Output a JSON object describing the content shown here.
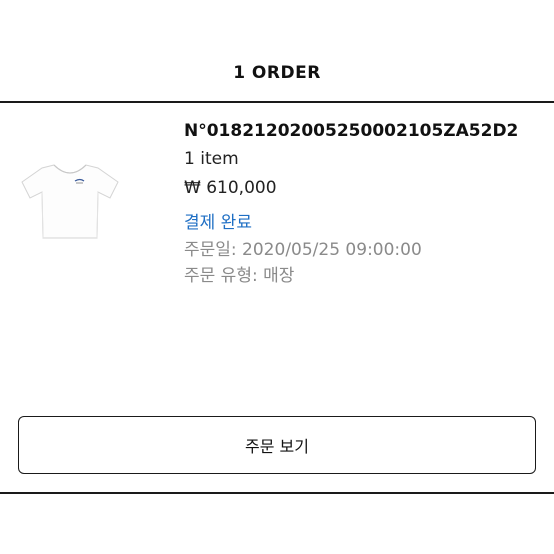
{
  "header": {
    "title": "1 ORDER"
  },
  "order": {
    "number": "N°01821202005250002105ZA52D2",
    "item_count": "1 item",
    "price": "₩ 610,000",
    "status": "결제 완료",
    "status_color": "#1f6fc4",
    "order_date": "주문일: 2020/05/25 09:00:00",
    "order_type": "주문 유형: 매장",
    "thumbnail_icon": "white-tshirt-icon"
  },
  "actions": {
    "view_order_label": "주문 보기"
  }
}
